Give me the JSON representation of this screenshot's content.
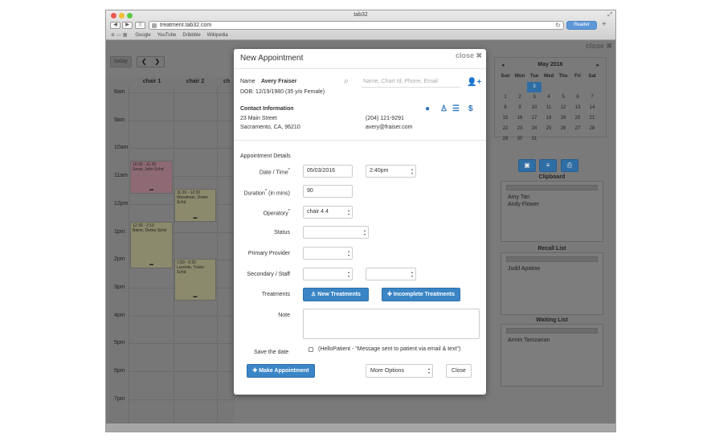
{
  "browser": {
    "title": "tab32",
    "url": "treatment.tab32.com",
    "reader": "Reader",
    "bookmarks": [
      "Google",
      "YouTube",
      "Dribbble",
      "Wikipedia"
    ]
  },
  "page": {
    "close": "close ✖",
    "today": "today"
  },
  "calendar": {
    "chairs": [
      "chair 1",
      "chair 2",
      "ch"
    ],
    "times": [
      "8am",
      "9am",
      "10am",
      "11am",
      "12pm",
      "1pm",
      "2pm",
      "3pm",
      "4pm",
      "5pm",
      "6pm",
      "7pm"
    ],
    "events": [
      {
        "time": "10:20 - 11:30",
        "text": "Snow, John Schd",
        "color": "#8e6a74"
      },
      {
        "time": "11:20 - 12:30",
        "text": "Woodman, Drake Schd",
        "color": "#8c8a6c"
      },
      {
        "time": "12:30 - 2:10",
        "text": "Baine, Debra Schd",
        "color": "#8c8a6c"
      },
      {
        "time": "1:50 - 3:20",
        "text": "Lucente, Travis Schd",
        "color": "#8c8a6c"
      }
    ]
  },
  "minical": {
    "month": "May 2016",
    "prev": "◂",
    "next": "▸",
    "days": [
      "Sun",
      "Mon",
      "Tue",
      "Wed",
      "Thu",
      "Fri",
      "Sat"
    ],
    "dates": [
      "",
      "",
      "3",
      "",
      "",
      "",
      "",
      "1",
      "2",
      "3",
      "4",
      "5",
      "6",
      "7",
      "8",
      "9",
      "10",
      "11",
      "12",
      "13",
      "14",
      "15",
      "16",
      "17",
      "18",
      "19",
      "20",
      "21",
      "22",
      "23",
      "24",
      "25",
      "26",
      "27",
      "28",
      "29",
      "30",
      "31",
      "",
      "",
      "",
      ""
    ],
    "selected": "3"
  },
  "sidepanel": {
    "clipboard": {
      "title": "Clipboard",
      "items": [
        "Amy Tan",
        "Andy Flower"
      ]
    },
    "recall": {
      "title": "Recall List",
      "items": [
        "Judd Apatow"
      ]
    },
    "waiting": {
      "title": "Waiting List",
      "items": [
        "Armin Tamzarian"
      ]
    }
  },
  "modal": {
    "title": "New Appointment",
    "close": "close ✖",
    "patient": {
      "name_label": "Name",
      "name": "Avery Fraiser",
      "dob": "DOB: 12/19/1980  (35  y/o  Female)",
      "search_placeholder": "Name, Chart Id, Phone, Email"
    },
    "contact": {
      "title": "Contact Information",
      "street": "23 Main Street",
      "city": "Sacramento, CA, 96210",
      "phone": "(204) 121-9291",
      "email": "avery@fraiser.com"
    },
    "details": {
      "title": "Appointment Details",
      "date_label": "Date / Time",
      "date": "05/03/2016",
      "time": "2:40pm",
      "duration_label": "Duration",
      "duration_unit": "(in mins)",
      "duration": "90",
      "operatory_label": "Operatory",
      "operatory": "chair 4 4",
      "status_label": "Status",
      "primary_label": "Primary Provider",
      "secondary_label": "Secondary / Staff",
      "treatments_label": "Treatments",
      "new_treatments": "New Treatments",
      "incomplete_treatments": "Incomplete Treatments",
      "note_label": "Note",
      "save_label": "Save the date",
      "hello": "(HelloPatient - \"Message sent to patient via email & text\")",
      "make": "Make Appointment",
      "more": "More Options",
      "close_btn": "Close"
    }
  }
}
